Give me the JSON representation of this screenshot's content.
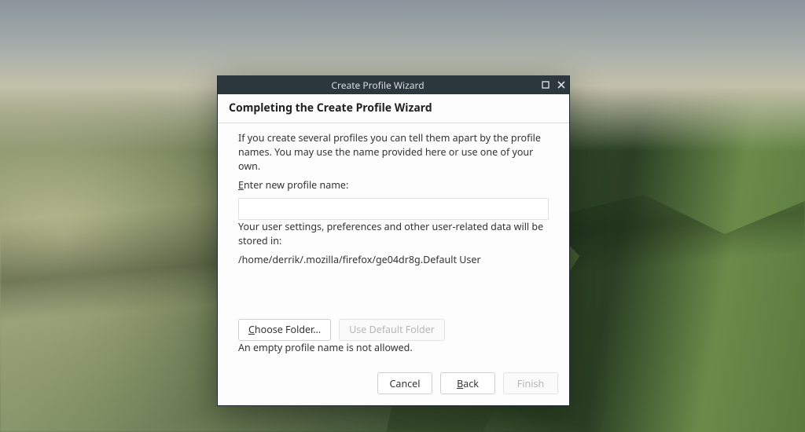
{
  "window": {
    "title": "Create Profile Wizard"
  },
  "heading": "Completing the Create Profile Wizard",
  "intro": "If you create several profiles you can tell them apart by the profile names. You may use the name provided here or use one of your own.",
  "profile_name": {
    "prefix": "E",
    "rest": "nter new profile name:",
    "value": ""
  },
  "storage_line": "Your user settings, preferences and other user-related data will be stored in:",
  "storage_path": "/home/derrik/.mozilla/firefox/ge04dr8g.Default User",
  "buttons": {
    "choose_folder_prefix": "C",
    "choose_folder_rest": "hoose Folder…",
    "use_default": "Use Default Folder",
    "cancel": "Cancel",
    "back_prefix": "B",
    "back_rest": "ack",
    "finish": "Finish"
  },
  "error": "An empty profile name is not allowed."
}
